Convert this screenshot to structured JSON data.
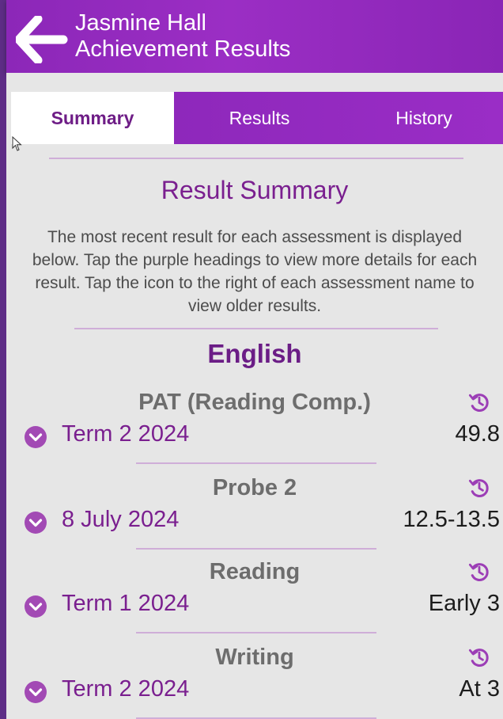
{
  "header": {
    "student_name": "Jasmine Hall",
    "page_title": "Achievement Results"
  },
  "tabs": [
    {
      "label": "Summary",
      "active": true
    },
    {
      "label": "Results",
      "active": false
    },
    {
      "label": "History",
      "active": false
    }
  ],
  "summary": {
    "title": "Result Summary",
    "description": "The most recent result for each assessment is displayed below. Tap the purple headings to view more details for each result. Tap the icon to the right of each assessment name to view older results."
  },
  "section": {
    "title": "English",
    "assessments": [
      {
        "name": "PAT (Reading Comp.)",
        "date": "Term 2 2024",
        "value": "49.8"
      },
      {
        "name": "Probe 2",
        "date": "8 July 2024",
        "value": "12.5-13.5"
      },
      {
        "name": "Reading",
        "date": "Term 1 2024",
        "value": "Early 3"
      },
      {
        "name": "Writing",
        "date": "Term 2 2024",
        "value": "At 3"
      }
    ]
  },
  "icons": {
    "back": "arrow-left-icon",
    "history": "history-icon",
    "expand": "chevron-down-circle-icon"
  },
  "colors": {
    "header_purple": "#9b2ec4",
    "heading_purple": "#7a1f8f",
    "background": "#e6e6e6"
  }
}
